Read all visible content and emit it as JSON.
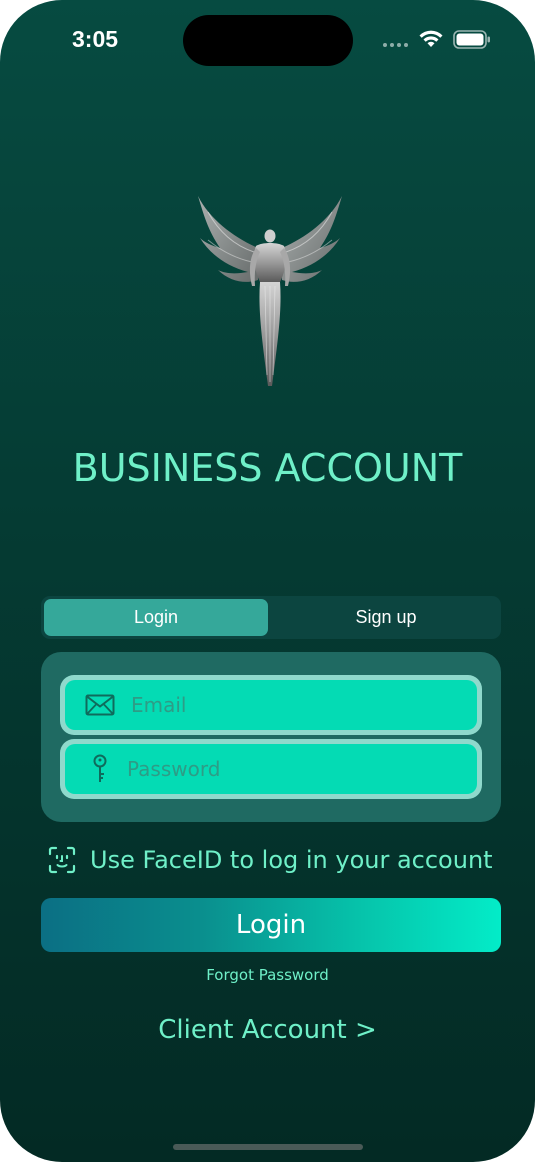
{
  "status_bar": {
    "time": "3:05"
  },
  "screen": {
    "title": "BUSINESS ACCOUNT"
  },
  "segment": {
    "login_label": "Login",
    "signup_label": "Sign up",
    "selected": "Login"
  },
  "form": {
    "email_placeholder": "Email",
    "email_value": "",
    "password_placeholder": "Password",
    "password_value": "",
    "email_icon": "envelope-icon",
    "password_icon": "key-icon"
  },
  "faceid": {
    "icon": "faceid-icon",
    "label": "Use FaceID to log in your account"
  },
  "actions": {
    "login_button": "Login",
    "forgot_password": "Forgot Password",
    "client_account": "Client Account >"
  },
  "colors": {
    "accent_text": "#6ff0c8",
    "field_fill": "#04dbb4",
    "segment_selected": "#35a89a",
    "background_top": "#064b41",
    "background_bottom": "#032a24"
  }
}
